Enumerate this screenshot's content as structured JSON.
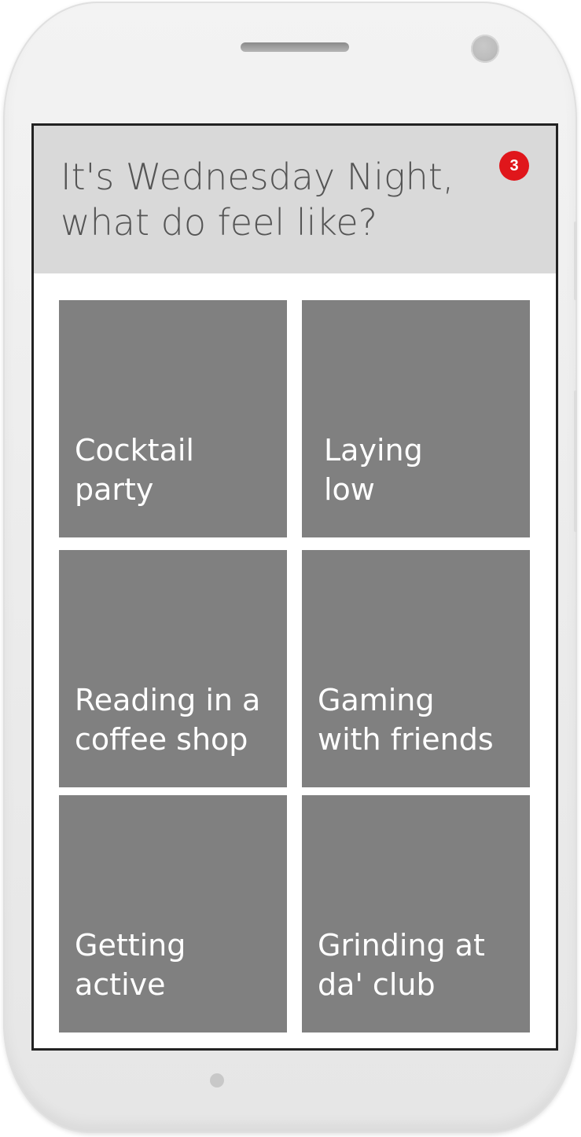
{
  "header": {
    "title_line1": "It's Wednesday Night,",
    "title_line2": "what do feel like?",
    "badge_count": "3",
    "background": "#d9d9d9",
    "badge_color": "#e0161b"
  },
  "tiles": [
    {
      "line1": "Cocktail",
      "line2": "party"
    },
    {
      "line1": "Laying",
      "line2": "low"
    },
    {
      "line1": "Reading in a",
      "line2": "coffee shop"
    },
    {
      "line1": "Gaming",
      "line2": "with friends"
    },
    {
      "line1": "Getting",
      "line2": "active"
    },
    {
      "line1": "Grinding at",
      "line2": "da' club"
    }
  ],
  "tile_color": "#808080"
}
